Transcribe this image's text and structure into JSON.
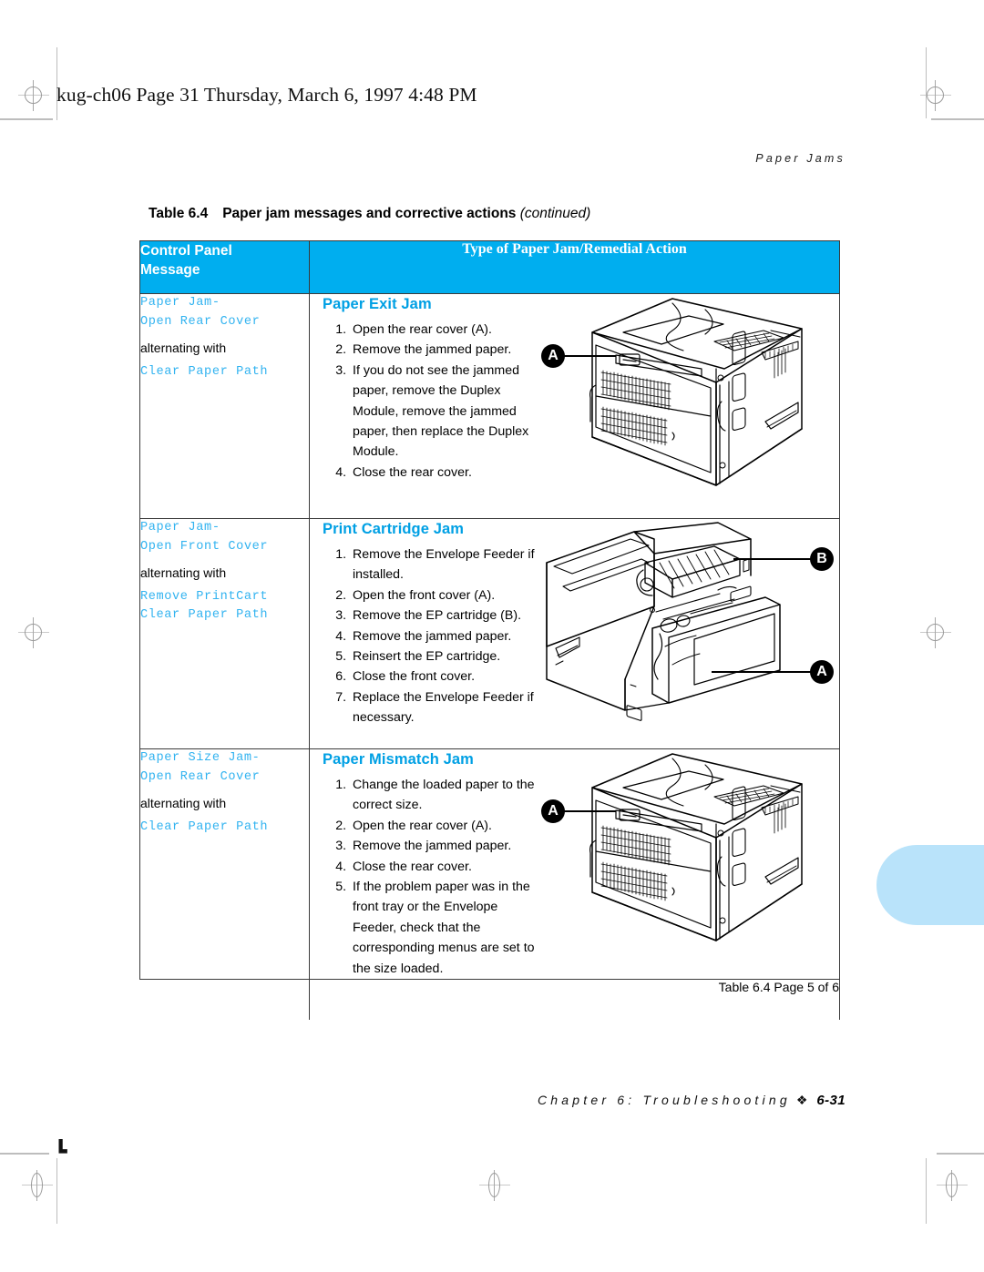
{
  "file_header": "kug-ch06  Page 31  Thursday, March 6, 1997  4:48 PM",
  "running_head": "Paper Jams",
  "table_caption": {
    "number": "Table 6.4",
    "title": "Paper jam messages and corrective actions",
    "continued": "(continued)"
  },
  "table": {
    "headers": {
      "col1_line1": "Control Panel",
      "col1_line2": "Message",
      "col2": "Type of Paper Jam/Remedial Action"
    },
    "rows": [
      {
        "message": {
          "primary": [
            "Paper Jam-",
            "Open Rear Cover"
          ],
          "connector": "alternating with",
          "secondary": [
            "Clear Paper Path"
          ]
        },
        "jam_title": "Paper Exit Jam",
        "steps": [
          "Open the rear cover (A).",
          "Remove the jammed paper.",
          "If you do not see the jammed paper, remove the Duplex Module, remove the jammed paper, then replace the Duplex Module.",
          "Close the rear cover."
        ],
        "illustration": "printer-rear-view",
        "callouts": [
          "A"
        ]
      },
      {
        "message": {
          "primary": [
            "Paper Jam-",
            "Open Front Cover"
          ],
          "connector": "alternating with",
          "secondary": [
            "Remove PrintCart",
            "Clear Paper Path"
          ]
        },
        "jam_title": "Print Cartridge Jam",
        "steps": [
          "Remove the Envelope Feeder if installed.",
          "Open the front cover (A).",
          "Remove the EP cartridge (B).",
          "Remove the jammed paper.",
          "Reinsert the EP cartridge.",
          "Close the front cover.",
          "Replace the Envelope Feeder if necessary."
        ],
        "illustration": "printer-front-open-view",
        "callouts": [
          "B",
          "A"
        ]
      },
      {
        "message": {
          "primary": [
            "Paper Size Jam-",
            "Open Rear Cover"
          ],
          "connector": "alternating with",
          "secondary": [
            "Clear Paper Path"
          ]
        },
        "jam_title": "Paper Mismatch Jam",
        "steps": [
          "Change the loaded paper to the correct size.",
          "Open the rear cover (A).",
          "Remove the jammed paper.",
          "Close the rear cover.",
          "If the problem paper was in the front tray or the Envelope Feeder, check that the corresponding menus are set to the size loaded."
        ],
        "illustration": "printer-rear-view",
        "callouts": [
          "A"
        ]
      }
    ],
    "footnote": "Table 6.4  Page 5 of 6"
  },
  "footer": {
    "chapter": "Chapter 6: Troubleshooting",
    "diamond": "❖",
    "page": "6-31"
  },
  "colors": {
    "header_blue": "#00aeef",
    "title_blue": "#00a0e4",
    "mono_blue": "#32b3f0",
    "thumb_tab": "#b9e3fa"
  }
}
